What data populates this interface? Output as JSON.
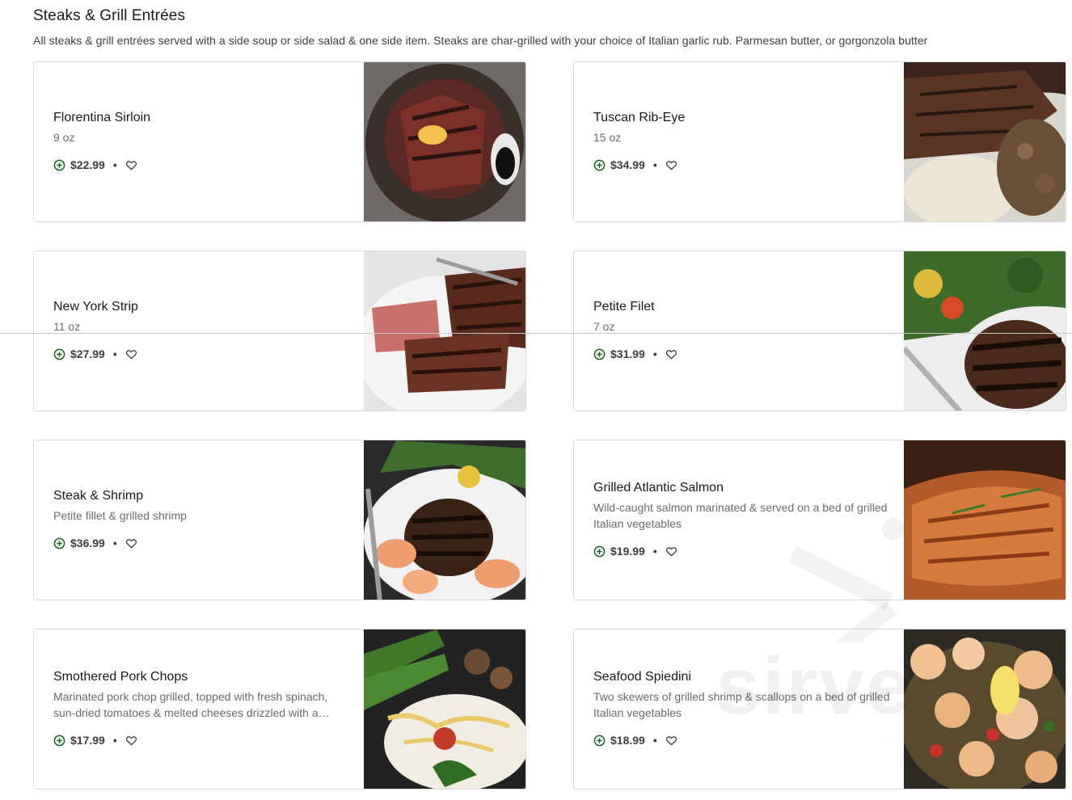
{
  "section": {
    "title": "Steaks & Grill Entrées",
    "description": "All steaks & grill entrées served with a side soup or side salad & one side item. Steaks are char-grilled with your choice of Italian garlic rub. Parmesan butter, or gorgonzola butter"
  },
  "items": [
    {
      "name": "Florentina Sirloin",
      "desc": "9 oz",
      "price": "$22.99"
    },
    {
      "name": "Tuscan Rib-Eye",
      "desc": "15 oz",
      "price": "$34.99"
    },
    {
      "name": "New York Strip",
      "desc": "11 oz",
      "price": "$27.99"
    },
    {
      "name": "Petite Filet",
      "desc": "7 oz",
      "price": "$31.99"
    },
    {
      "name": "Steak & Shrimp",
      "desc": "Petite fillet & grilled shrimp",
      "price": "$36.99"
    },
    {
      "name": "Grilled Atlantic Salmon",
      "desc": "Wild-caught salmon marinated & served on a bed of grilled Italian vegetables",
      "price": "$19.99"
    },
    {
      "name": "Smothered Pork Chops",
      "desc": "Marinated pork chop grilled, topped with fresh spinach, sun-dried tomatoes & melted cheeses drizzled with a…",
      "price": "$17.99"
    },
    {
      "name": "Seafood Spiedini",
      "desc": "Two skewers of grilled shrimp & scallops on a bed of grilled Italian vegetables",
      "price": "$18.99"
    }
  ],
  "icons": {
    "add": "add-circle-icon",
    "favorite": "heart-icon"
  },
  "watermark": {
    "text": "sirve"
  },
  "colors": {
    "accent": "#2e7d32",
    "text": "#191919",
    "muted": "#6a6a6a",
    "border": "#dadada"
  }
}
